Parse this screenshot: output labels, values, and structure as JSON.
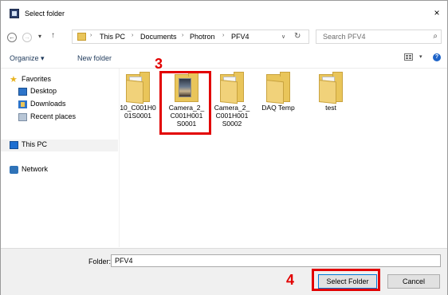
{
  "window": {
    "title": "Select folder",
    "close_glyph": "×"
  },
  "nav": {
    "back": "←",
    "forward": "→",
    "dropdown": "▾",
    "up": "↑"
  },
  "address": {
    "crumbs": [
      "This PC",
      "Documents",
      "Photron",
      "PFV4"
    ],
    "separator": "›",
    "dropdown": "∨",
    "refresh": "↻"
  },
  "search": {
    "placeholder": "Search PFV4",
    "icon": "⌕"
  },
  "toolbar": {
    "organize": "Organize ▾",
    "new_folder": "New folder",
    "view_dropdown": "▾",
    "help": "?"
  },
  "sidebar": {
    "favorites": "Favorites",
    "items": [
      "Desktop",
      "Downloads",
      "Recent places"
    ],
    "this_pc": "This PC",
    "network": "Network"
  },
  "files": [
    {
      "name": "10_C001H001S0001",
      "kind": "folder-doc"
    },
    {
      "name": "Camera_2_C001H001S0001",
      "kind": "folder-camera"
    },
    {
      "name": "Camera_2_C001H001S0002",
      "kind": "folder-doc"
    },
    {
      "name": "DAQ Temp",
      "kind": "folder"
    },
    {
      "name": "test",
      "kind": "folder-doc"
    }
  ],
  "annotations": {
    "callout_3": "3",
    "callout_4": "4",
    "color": "#e20000"
  },
  "bottom": {
    "folder_label": "Folder:",
    "folder_value": "PFV4",
    "select_button": "Select Folder",
    "cancel_button": "Cancel"
  },
  "colors": {
    "folder": "#e9c55a",
    "accent": "#0078d7",
    "link": "#1e395b"
  }
}
